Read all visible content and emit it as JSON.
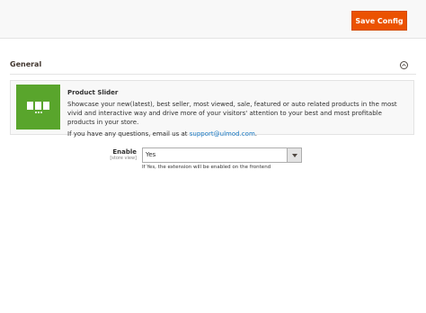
{
  "toolbar": {
    "save_label": "Save Config"
  },
  "section": {
    "title": "General"
  },
  "extension": {
    "name": "Product Slider",
    "description": "Showcase your new(latest), best seller, most viewed, sale, featured or auto related products in the most vivid and interactive way and drive more of your visitors' attention to your best and most profitable products in your store.",
    "contact_prefix": "If you have any questions, email us at ",
    "contact_email": "support@ulmod.com",
    "contact_suffix": ".",
    "logo_color": "#59a52c"
  },
  "field": {
    "label": "Enable",
    "scope": "[store view]",
    "value": "Yes",
    "note": "If Yes, the extension will be enabled on the frontend"
  },
  "colors": {
    "accent": "#eb5202",
    "link": "#1979c3"
  }
}
